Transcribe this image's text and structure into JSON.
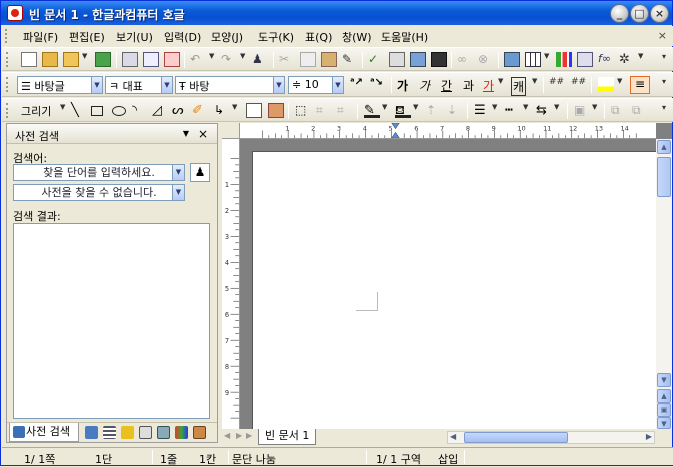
{
  "window": {
    "title": "빈 문서 1 - 한글과컴퓨터 호글"
  },
  "menu": [
    "파일(F)",
    "편집(E)",
    "보기(U)",
    "입력(D)",
    "모양(J)",
    "도구(K)",
    "표(Q)",
    "창(W)",
    "도움말(H)"
  ],
  "format": {
    "style": "바탕글",
    "lang_font": "대표",
    "font": "바탕",
    "size": "10",
    "bold": "가",
    "italic": "가",
    "underline": "간",
    "strike": "과",
    "color_text": "가",
    "outline": "캐"
  },
  "draw_toolbar": {
    "label": "그리기"
  },
  "panel": {
    "title": "사전 검색",
    "search_label": "검색어:",
    "search_placeholder": "찾을 단어를 입력하세요.",
    "dict_value": "사전을 찾을 수 없습니다.",
    "results_label": "검색 결과:",
    "tab_label": "사전 검색"
  },
  "document": {
    "tab_label": "빈 문서 1"
  },
  "ruler": {
    "marks": [
      "1",
      "2",
      "3",
      "4",
      "5",
      "6",
      "7",
      "8",
      "9",
      "10",
      "11",
      "12",
      "13",
      "14",
      "15"
    ]
  },
  "status": {
    "page": "1/ 1쪽",
    "section": "1단",
    "line": "1줄",
    "column": "1칸",
    "para": "문단 나눔",
    "area": "1/ 1 구역",
    "mode": "삽입"
  },
  "colors": {
    "title_bar": "#0a5bd8",
    "accent": "#3b6fb6"
  }
}
